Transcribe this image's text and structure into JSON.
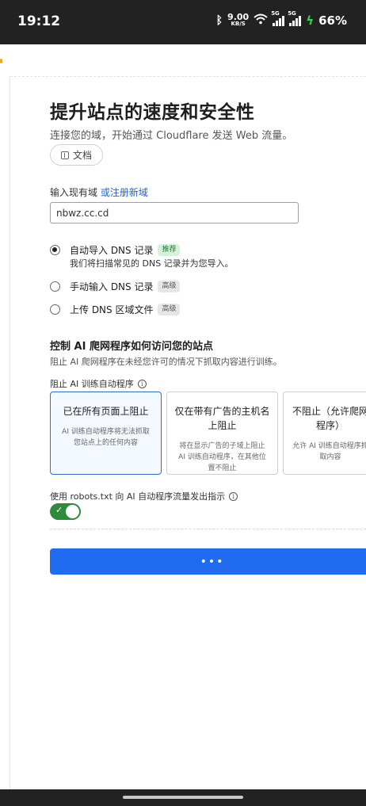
{
  "status_bar": {
    "time": "19:12",
    "net_speed_value": "9.00",
    "net_speed_unit": "KB/S",
    "signal1_type": "5G",
    "signal2_type": "5G",
    "battery": "66%"
  },
  "setup": {
    "title": "提升站点的速度和安全性",
    "subtitle": "连接您的域，开始通过 Cloudflare 发送 Web 流量。",
    "docs_label": "文档",
    "domain_prefix": "输入现有域",
    "domain_link": "或注册新域",
    "domain_value": "nbwz.cc.cd"
  },
  "dns_options": {
    "auto": {
      "label": "自动导入 DNS 记录",
      "badge": "推荐",
      "desc": "我们将扫描常见的 DNS 记录并为您导入。"
    },
    "manual": {
      "label": "手动输入 DNS 记录",
      "badge": "高级"
    },
    "upload": {
      "label": "上传 DNS 区域文件",
      "badge": "高级"
    }
  },
  "ai_control": {
    "title": "控制 AI 爬网程序如何访问您的站点",
    "desc": "阻止 AI 爬网程序在未经您许可的情况下抓取内容进行训练。",
    "block_label": "阻止 AI 训练自动程序",
    "cards": [
      {
        "title": "已在所有页面上阻止",
        "desc": "AI 训练自动程序将无法抓取您站点上的任何内容",
        "selected": true
      },
      {
        "title": "仅在带有广告的主机名上阻止",
        "desc": "将在显示广告的子域上阻止 AI 训练自动程序，在其他位置不阻止",
        "selected": false
      },
      {
        "title": "不阻止（允许爬网程序）",
        "desc": "允许 AI 训练自动程序抓取内容",
        "selected": false
      }
    ],
    "robots_label": "使用 robots.txt 向 AI 自动程序流量发出指示",
    "robots_enabled": true
  },
  "continue_button": {
    "label": "•••"
  },
  "icons": {
    "info": "info-icon",
    "docs": "book-icon",
    "toggle_check": "check-icon"
  },
  "colors": {
    "accent": "#1f6cf0",
    "toggle_on": "#2e8b3a",
    "link": "#1a64d6"
  }
}
